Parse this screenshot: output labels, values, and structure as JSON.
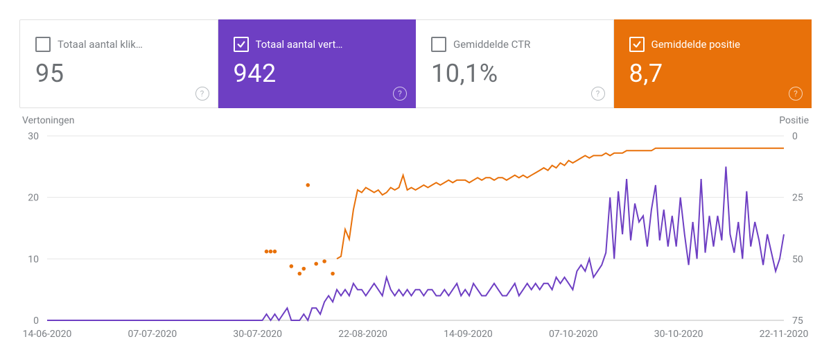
{
  "cards": [
    {
      "key": "clicks",
      "label": "Totaal aantal klik…",
      "value": "95",
      "active": false
    },
    {
      "key": "impressions",
      "label": "Totaal aantal vert…",
      "value": "942",
      "active": true,
      "color": "#6e3fc3"
    },
    {
      "key": "ctr",
      "label": "Gemiddelde CTR",
      "value": "10,1%",
      "active": false
    },
    {
      "key": "position",
      "label": "Gemiddelde positie",
      "value": "8,7",
      "active": true,
      "color": "#e8710a"
    }
  ],
  "chart": {
    "leftAxisTitle": "Vertoningen",
    "rightAxisTitle": "Positie",
    "yLeftTicks": [
      0,
      10,
      20,
      30
    ],
    "yRightTicks": [
      0,
      25,
      50,
      75
    ],
    "xTicks": [
      "14-06-2020",
      "07-07-2020",
      "30-07-2020",
      "22-08-2020",
      "14-09-2020",
      "07-10-2020",
      "30-10-2020",
      "22-11-2020"
    ],
    "colors": {
      "impressions": "#6e3fc3",
      "position": "#e8710a"
    }
  },
  "chart_data": {
    "type": "line",
    "title": "",
    "xlabel": "",
    "x": [
      "14-06-2020",
      "07-07-2020",
      "30-07-2020",
      "22-08-2020",
      "14-09-2020",
      "07-10-2020",
      "30-10-2020",
      "22-11-2020"
    ],
    "series": [
      {
        "name": "Vertoningen",
        "axis": "left",
        "ylim": [
          0,
          30
        ],
        "ylabel": "Vertoningen",
        "values": [
          0,
          0,
          0,
          0,
          0,
          0,
          0,
          0,
          0,
          0,
          0,
          0,
          0,
          0,
          0,
          0,
          0,
          0,
          0,
          0,
          0,
          0,
          0,
          0,
          0,
          0,
          0,
          0,
          0,
          0,
          0,
          0,
          0,
          0,
          0,
          0,
          0,
          0,
          0,
          0,
          0,
          0,
          0,
          0,
          0,
          0,
          0,
          0,
          0,
          0,
          0,
          0,
          0,
          1,
          0,
          1,
          0,
          1,
          2,
          0,
          0,
          0,
          1,
          0,
          2,
          2,
          1,
          3,
          4,
          3,
          5,
          4,
          5,
          4,
          6,
          5,
          5,
          4,
          5,
          6,
          5,
          4,
          7,
          5,
          4,
          5,
          4,
          5,
          4,
          5,
          5,
          4,
          5,
          5,
          4,
          4,
          5,
          4,
          5,
          6,
          4,
          5,
          4,
          6,
          5,
          4,
          4,
          5,
          6,
          5,
          4,
          4,
          5,
          6,
          4,
          5,
          6,
          5,
          6,
          5,
          6,
          6,
          5,
          7,
          6,
          7,
          6,
          5,
          8,
          9,
          8,
          10,
          7,
          8,
          9,
          11,
          20,
          10,
          21,
          14,
          23,
          13,
          19,
          16,
          17,
          12,
          18,
          22,
          13,
          18,
          12,
          17,
          12,
          20,
          14,
          9,
          16,
          10,
          23,
          11,
          17,
          12,
          17,
          13,
          25,
          14,
          11,
          16,
          10,
          21,
          12,
          16,
          13,
          9,
          14,
          11,
          8,
          10,
          14
        ]
      },
      {
        "name": "Positie",
        "axis": "right",
        "ylim_reversed": [
          0,
          75
        ],
        "ylabel": "Positie",
        "sparse": true,
        "values": [
          [
            53,
            47
          ],
          [
            54,
            47
          ],
          [
            55,
            47
          ],
          [
            59,
            53
          ],
          [
            61,
            56
          ],
          [
            62,
            54
          ],
          [
            63,
            20
          ],
          [
            65,
            52
          ],
          [
            67,
            51
          ],
          [
            69,
            56
          ],
          [
            70,
            50
          ],
          [
            71,
            49
          ],
          [
            72,
            38
          ],
          [
            73,
            42
          ],
          [
            74,
            30
          ],
          [
            75,
            22
          ],
          [
            76,
            23
          ],
          [
            77,
            21
          ],
          [
            78,
            22
          ],
          [
            79,
            23
          ],
          [
            80,
            22
          ],
          [
            81,
            24
          ],
          [
            82,
            23
          ],
          [
            83,
            21
          ],
          [
            84,
            22
          ],
          [
            85,
            21
          ],
          [
            86,
            16
          ],
          [
            87,
            22
          ],
          [
            88,
            21
          ],
          [
            89,
            22
          ],
          [
            90,
            21
          ],
          [
            91,
            20
          ],
          [
            92,
            21
          ],
          [
            93,
            20
          ],
          [
            94,
            19
          ],
          [
            95,
            20
          ],
          [
            96,
            19
          ],
          [
            97,
            18
          ],
          [
            98,
            19
          ],
          [
            99,
            18
          ],
          [
            100,
            18
          ],
          [
            101,
            18
          ],
          [
            102,
            19
          ],
          [
            103,
            18
          ],
          [
            104,
            17
          ],
          [
            105,
            18
          ],
          [
            106,
            17
          ],
          [
            107,
            17
          ],
          [
            108,
            18
          ],
          [
            109,
            17
          ],
          [
            110,
            17
          ],
          [
            111,
            18
          ],
          [
            112,
            17
          ],
          [
            113,
            16
          ],
          [
            114,
            17
          ],
          [
            115,
            16
          ],
          [
            116,
            17
          ],
          [
            117,
            16
          ],
          [
            118,
            15
          ],
          [
            119,
            14
          ],
          [
            120,
            13
          ],
          [
            121,
            14
          ],
          [
            122,
            12
          ],
          [
            123,
            13
          ],
          [
            124,
            11
          ],
          [
            125,
            12
          ],
          [
            126,
            10
          ],
          [
            127,
            11
          ],
          [
            128,
            10
          ],
          [
            129,
            9
          ],
          [
            130,
            8
          ],
          [
            131,
            9
          ],
          [
            132,
            8
          ],
          [
            133,
            8
          ],
          [
            134,
            8
          ],
          [
            135,
            7
          ],
          [
            136,
            8
          ],
          [
            137,
            7
          ],
          [
            138,
            7
          ],
          [
            139,
            7
          ],
          [
            140,
            6
          ],
          [
            141,
            6
          ],
          [
            142,
            6
          ],
          [
            143,
            6
          ],
          [
            144,
            6
          ],
          [
            145,
            6
          ],
          [
            146,
            6
          ],
          [
            147,
            5
          ],
          [
            148,
            5
          ],
          [
            149,
            5
          ],
          [
            150,
            5
          ],
          [
            151,
            5
          ],
          [
            152,
            5
          ],
          [
            153,
            5
          ],
          [
            154,
            5
          ],
          [
            155,
            5
          ],
          [
            156,
            5
          ],
          [
            157,
            5
          ],
          [
            158,
            5
          ],
          [
            159,
            5
          ],
          [
            160,
            5
          ],
          [
            161,
            5
          ],
          [
            162,
            5
          ],
          [
            163,
            5
          ],
          [
            164,
            5
          ],
          [
            165,
            5
          ],
          [
            166,
            5
          ],
          [
            167,
            5
          ],
          [
            168,
            5
          ],
          [
            169,
            5
          ],
          [
            170,
            5
          ],
          [
            171,
            5
          ],
          [
            172,
            5
          ],
          [
            173,
            5
          ],
          [
            174,
            5
          ],
          [
            175,
            5
          ],
          [
            176,
            5
          ],
          [
            177,
            5
          ],
          [
            178,
            5
          ]
        ]
      }
    ]
  }
}
